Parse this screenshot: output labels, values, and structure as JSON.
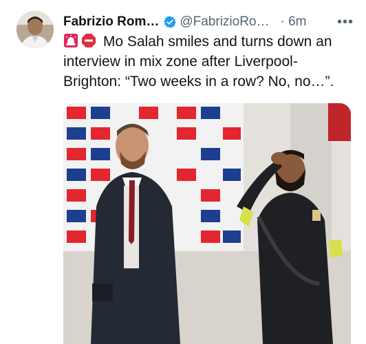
{
  "author": {
    "display_name": "Fabrizio Rom…",
    "handle": "@FabrizioRo…",
    "time": "· 6m",
    "avatar_icon": "profile-photo",
    "verified_icon": "verified-badge-icon"
  },
  "menu": {
    "more_label": "•••"
  },
  "tweet": {
    "emoji_1": "police-siren-light",
    "emoji_2": "stop-sign",
    "line_1": " Mo Salah smiles and turns down an",
    "line_2": "interview in mix zone after Liverpool-",
    "line_3": "Brighton: “Two weeks in a row? No, no…”."
  },
  "media": {
    "type": "photo",
    "description_icon": "photo-media"
  },
  "colors": {
    "text": "#0f1419",
    "secondary": "#536471",
    "verified": "#1d9bf0",
    "siren": "#e0245e",
    "stop": "#dd2e44"
  }
}
